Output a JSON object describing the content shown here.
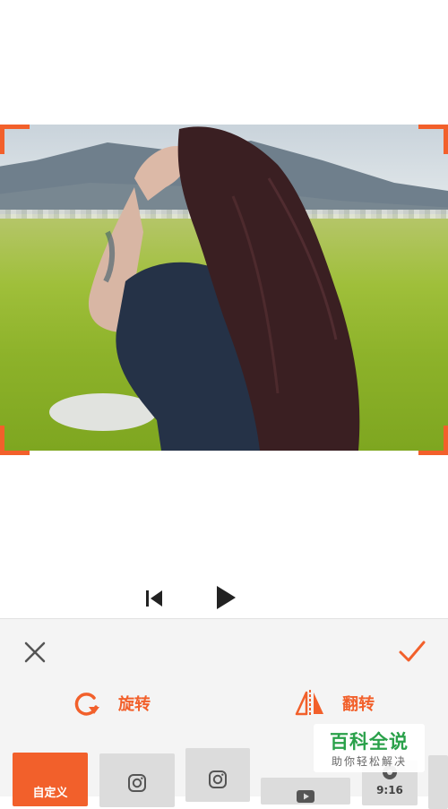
{
  "transport": {
    "prev_icon": "skip-previous-icon",
    "play_icon": "play-icon"
  },
  "panel": {
    "close_icon": "close-icon",
    "confirm_icon": "checkmark-icon",
    "accent_color": "#f2602b",
    "tools": [
      {
        "label": "旋转",
        "icon": "rotate-icon"
      },
      {
        "label": "翻转",
        "icon": "flip-icon"
      }
    ],
    "ratios": [
      {
        "label": "自定义",
        "active": true
      },
      {
        "label": "",
        "icon": "instagram-icon"
      },
      {
        "label": "",
        "icon": "instagram-icon"
      },
      {
        "label": "",
        "icon": "youtube-icon"
      },
      {
        "label": "9:16",
        "icon": "tiktok-icon"
      },
      {
        "label": ""
      }
    ]
  },
  "watermark": {
    "title": "百科全说",
    "subtitle": "助你轻松解决"
  }
}
